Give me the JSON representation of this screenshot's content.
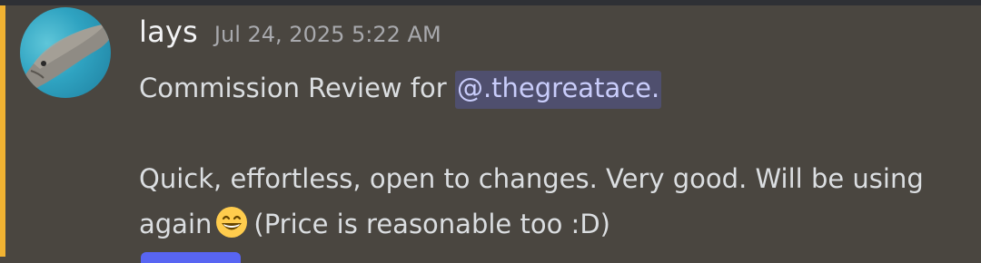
{
  "message": {
    "author": "lays",
    "timestamp": "Jul 24, 2025 5:22 AM",
    "line1_prefix": "Commission Review for ",
    "mention": "@.thegreatace.",
    "line2": "Quick, effortless, open to changes. Very good. Will be using",
    "line3_prefix": "again",
    "emoji": "grinning-face-with-smiling-eyes",
    "line3_suffix": "(Price is reasonable too :D)"
  },
  "colors": {
    "background": "#4a4640",
    "highlight_bar": "#f0b232",
    "mention_bg": "#4f4f6e",
    "mention_text": "#c9cdfb",
    "username": "#f2f3f5",
    "timestamp": "#a8a9ad",
    "text": "#dbdee1"
  }
}
